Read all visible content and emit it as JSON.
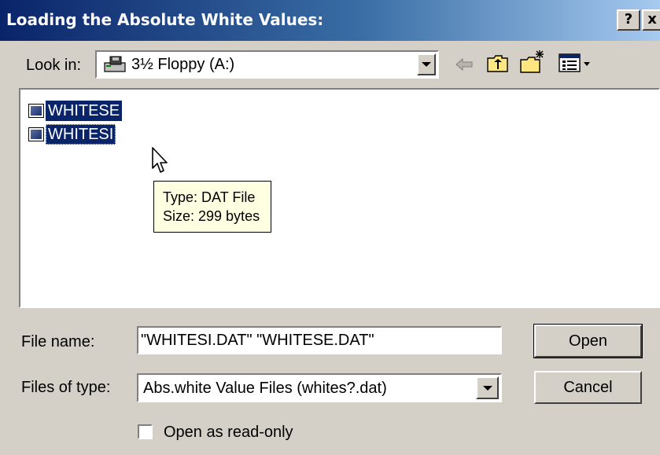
{
  "dialog": {
    "title": "Loading the Absolute White Values:",
    "help_label": "?",
    "close_label": "x"
  },
  "look_in": {
    "label": "Look in:",
    "value": "3½ Floppy (A:)"
  },
  "files": [
    {
      "name": "WHITESE",
      "selected": true
    },
    {
      "name": "WHITESI",
      "selected": true,
      "focused": true
    }
  ],
  "tooltip": {
    "type_line": "Type: DAT File",
    "size_line": "Size: 299 bytes"
  },
  "file_name": {
    "label": "File name:",
    "value": "\"WHITESI.DAT\" \"WHITESE.DAT\""
  },
  "file_type": {
    "label": "Files of type:",
    "value": "Abs.white Value Files (whites?.dat)"
  },
  "buttons": {
    "open": "Open",
    "cancel": "Cancel"
  },
  "read_only": {
    "label": "Open as read-only",
    "checked": false
  },
  "colors": {
    "titlebar_start": "#0a246a",
    "titlebar_end": "#a6caf0",
    "selection": "#0a246a",
    "face": "#d4d0c8",
    "tooltip_bg": "#ffffe1"
  },
  "icons": [
    "floppy-drive-icon",
    "back-arrow-icon",
    "up-folder-icon",
    "new-folder-icon",
    "view-menu-icon",
    "dat-file-icon",
    "mouse-cursor-icon"
  ]
}
